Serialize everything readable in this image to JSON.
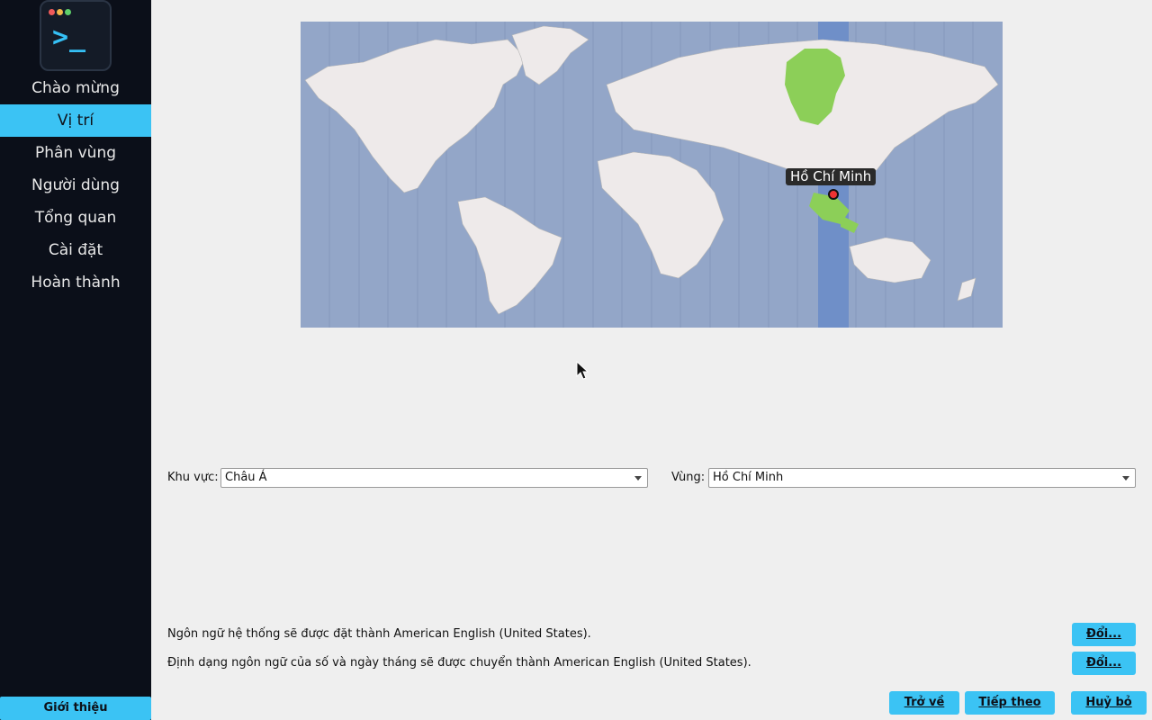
{
  "sidebar": {
    "logo_prompt": ">_",
    "items": [
      {
        "label": "Chào mừng",
        "active": false
      },
      {
        "label": "Vị trí",
        "active": true
      },
      {
        "label": "Phân vùng",
        "active": false
      },
      {
        "label": "Người dùng",
        "active": false
      },
      {
        "label": "Tổng quan",
        "active": false
      },
      {
        "label": "Cài đặt",
        "active": false
      },
      {
        "label": "Hoàn thành",
        "active": false
      }
    ],
    "about_label": "Giới thiệu"
  },
  "map": {
    "selected_city": "Hồ Chí Minh"
  },
  "location": {
    "region_label": "Khu vực:",
    "region_value": "Châu Á",
    "zone_label": "Vùng:",
    "zone_value": "Hồ Chí Minh"
  },
  "locale": {
    "language_text": "Ngôn ngữ hệ thống sẽ được đặt thành American English (United States).",
    "format_text": "Định dạng ngôn ngữ của số và ngày tháng sẽ được chuyển thành American English (United States).",
    "change_label": "Đổi..."
  },
  "footer": {
    "back_label": "Trở về",
    "next_label": "Tiếp theo",
    "cancel_label": "Huỷ bỏ"
  },
  "colors": {
    "accent": "#3bc3f4",
    "sidebar_bg": "#0b0f19",
    "map_ocean": "#93a6c8",
    "timezone_band": "#6f8fc8",
    "timezone_highlight": "#8ccf58"
  }
}
